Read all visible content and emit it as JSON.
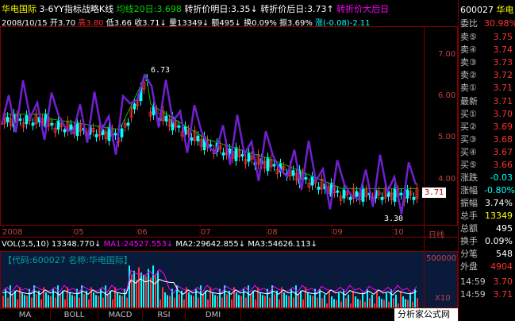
{
  "header": {
    "name": "华电国际",
    "formula": "3-6YY指标战略K线",
    "ma_label": "均线20日:3.698",
    "next_day": "转折价明日:3.35",
    "day_after": "转折价后日:3.73",
    "big_after": "转折价大后日",
    "date": "2008/10/15",
    "open": "开3.70",
    "high": "高3.80",
    "low": "低3.66",
    "close": "收3.71",
    "vol": "量13349",
    "amount": "额495",
    "turnover": "换0.09%",
    "amplitude": "振3.69%",
    "change": "涨(-0.08)-2.11"
  },
  "y_ticks": [
    "7.00",
    "6.00",
    "5.00",
    "4.00"
  ],
  "x_ticks": [
    "2008",
    "05",
    "06",
    "07",
    "08",
    "09",
    "10"
  ],
  "period_label": "日线",
  "annotations": {
    "high_mark": "6.73",
    "low_mark": "3.30",
    "current_price": "3.71"
  },
  "volume": {
    "header": "VOL(3,5,10)",
    "vol": "13348.770",
    "ma1": "MA1:24527.553",
    "ma2": "MA2:29642.855",
    "ma3": "MA3:54626.113",
    "code_box": "【代码:600027 名称:华电国际】",
    "scale_top": "500000",
    "scale_unit": "X10"
  },
  "tabs": [
    "MA",
    "BOLL",
    "MACD",
    "RSI",
    "DMI"
  ],
  "watermark": "分析家公式网www.88gg.com",
  "quote": {
    "code": "600027",
    "name": "华电",
    "wei_bi_label": "委比",
    "wei_bi": "30.98%",
    "sell": [
      {
        "label": "卖⑤",
        "price": "3.75"
      },
      {
        "label": "卖④",
        "price": "3.74"
      },
      {
        "label": "卖③",
        "price": "3.73"
      },
      {
        "label": "卖②",
        "price": "3.72"
      },
      {
        "label": "卖①",
        "price": "3.71"
      }
    ],
    "latest_label": "最新",
    "latest": "3.71",
    "buy": [
      {
        "label": "买①",
        "price": "3.70"
      },
      {
        "label": "买②",
        "price": "3.69"
      },
      {
        "label": "买③",
        "price": "3.68"
      },
      {
        "label": "买④",
        "price": "3.67"
      },
      {
        "label": "买⑤",
        "price": "3.66"
      }
    ],
    "stats": [
      {
        "label": "涨跌",
        "val": "-0.03"
      },
      {
        "label": "涨幅",
        "val": "-0.80%"
      },
      {
        "label": "振幅",
        "val": "3.74%"
      },
      {
        "label": "总手",
        "val": "13349"
      },
      {
        "label": "总额",
        "val": "495"
      },
      {
        "label": "换手",
        "val": "0.09%"
      },
      {
        "label": "分笔",
        "val": "548"
      },
      {
        "label": "外盘",
        "val": "4904"
      }
    ],
    "ticks": [
      {
        "time": "14:59",
        "price": "3.70"
      },
      {
        "time": "14:59",
        "price": "3.71"
      }
    ]
  },
  "colors": {
    "up": "#ff3232",
    "down": "#00ffff",
    "purple": "#7020d0",
    "ma": "#00c000"
  }
}
